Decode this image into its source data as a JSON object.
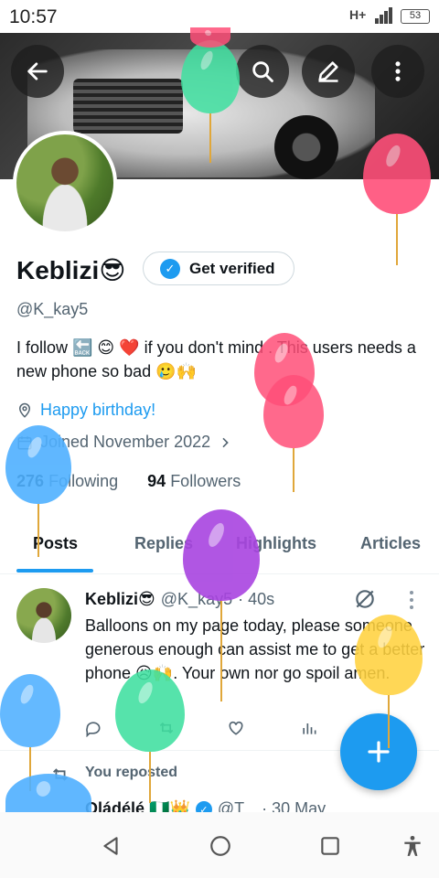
{
  "status_bar": {
    "time": "10:57",
    "network": "H+",
    "battery": "53"
  },
  "profile": {
    "name": "Keblizi😎",
    "verify_button": "Get verified",
    "handle": "@K_kay5",
    "bio": "I follow 🔙 😊 ❤️ if you don't mind . This users needs a new phone so bad 🥲🙌",
    "birthday": "Happy birthday!",
    "joined": "Joined November 2022",
    "following_count": "276",
    "following_label": "Following",
    "followers_count": "94",
    "followers_label": "Followers"
  },
  "tabs": [
    "Posts",
    "Replies",
    "Highlights",
    "Articles"
  ],
  "tweet": {
    "name": "Keblizi😎",
    "handle": "@K_kay5",
    "time": "· 40s",
    "text": "Balloons on my page today, please someone generous enough can assist me to get a better phone 😥🙌. Your own nor go spoil amen."
  },
  "repost": {
    "label": "You reposted",
    "name": "Oládélé 🇳🇬👑",
    "handle": "@T...",
    "time": "· 30 May"
  },
  "colors": {
    "accent": "#1d9bf0",
    "balloons": [
      "#ff4f79",
      "#3fe0a0",
      "#4fb0ff",
      "#a844e0",
      "#ffd23f"
    ]
  },
  "icons": [
    "back-arrow-icon",
    "search-icon",
    "edit-icon",
    "more-vertical-icon",
    "location-icon",
    "calendar-icon",
    "chevron-right-icon",
    "reply-icon",
    "retweet-icon",
    "like-icon",
    "analytics-icon",
    "share-icon",
    "grok-icon",
    "compose-plus-icon",
    "nav-back-icon",
    "nav-home-icon",
    "nav-recents-icon",
    "accessibility-icon"
  ]
}
